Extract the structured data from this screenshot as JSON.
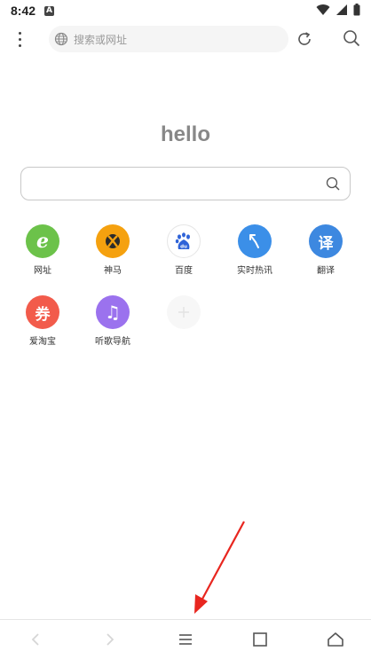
{
  "status_bar": {
    "time": "8:42",
    "notification_glyph": "A"
  },
  "top_bar": {
    "search_placeholder": "搜索或网址"
  },
  "main": {
    "greeting": "hello"
  },
  "shortcuts": [
    {
      "label": "网址",
      "glyph": "e",
      "color": "#6cc24a",
      "icon": "ie-icon"
    },
    {
      "label": "神马",
      "glyph": "",
      "color": "#f5a10f",
      "icon": "xbox-icon"
    },
    {
      "label": "百度",
      "glyph": "du",
      "color": "#ffffff",
      "icon": "baidu-paw-icon"
    },
    {
      "label": "实时热讯",
      "glyph": "",
      "color": "#3b8fe8",
      "icon": "arrow-cursor-icon"
    },
    {
      "label": "翻译",
      "glyph": "译",
      "color": "#3d88e0",
      "icon": "translate-icon"
    },
    {
      "label": "爱淘宝",
      "glyph": "券",
      "color": "#f25b4b",
      "icon": "coupon-icon"
    },
    {
      "label": "听歌导航",
      "glyph": "♫",
      "color": "#9b72ee",
      "icon": "music-note-icon"
    }
  ],
  "colors": {
    "arrow": "#e8261f"
  }
}
